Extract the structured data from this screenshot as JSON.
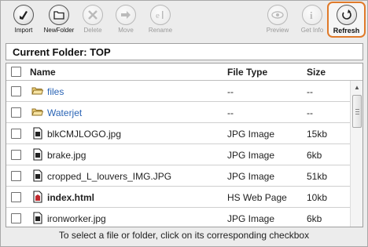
{
  "toolbar": {
    "buttons": [
      {
        "label": "Import",
        "icon": "import-icon",
        "enabled": true
      },
      {
        "label": "NewFolder",
        "icon": "new-folder-icon",
        "enabled": true
      },
      {
        "label": "Delete",
        "icon": "delete-icon",
        "enabled": false
      },
      {
        "label": "Move",
        "icon": "move-icon",
        "enabled": false
      },
      {
        "label": "Rename",
        "icon": "rename-icon",
        "enabled": false
      },
      {
        "label": "Preview",
        "icon": "preview-icon",
        "enabled": false
      },
      {
        "label": "Get Info",
        "icon": "info-icon",
        "enabled": false
      },
      {
        "label": "Refresh",
        "icon": "refresh-icon",
        "enabled": true,
        "highlighted": true
      }
    ]
  },
  "current_folder": "Current Folder: TOP",
  "table": {
    "columns": [
      "Name",
      "File Type",
      "Size"
    ],
    "rows": [
      {
        "name": "files",
        "type": "--",
        "size": "--",
        "kind": "folder"
      },
      {
        "name": "Waterjet",
        "type": "--",
        "size": "--",
        "kind": "folder"
      },
      {
        "name": "blkCMJLOGO.jpg",
        "type": "JPG Image",
        "size": "15kb",
        "kind": "file"
      },
      {
        "name": "brake.jpg",
        "type": "JPG Image",
        "size": "6kb",
        "kind": "file"
      },
      {
        "name": "cropped_L_louvers_IMG.JPG",
        "type": "JPG Image",
        "size": "51kb",
        "kind": "file"
      },
      {
        "name": "index.html",
        "type": "HS Web Page",
        "size": "10kb",
        "kind": "html"
      },
      {
        "name": "ironworker.jpg",
        "type": "JPG Image",
        "size": "6kb",
        "kind": "file"
      }
    ]
  },
  "footer_hint": "To select a file or folder, click on its corresponding checkbox",
  "colors": {
    "accent": "#e07a2a",
    "folder_link": "#2a64b5"
  }
}
